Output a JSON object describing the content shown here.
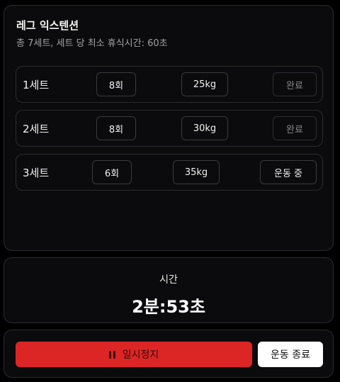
{
  "exercise": {
    "title": "레그 익스텐션",
    "subtitle": "총 7세트, 세트 당 최소 휴식시간: 60초"
  },
  "sets": [
    {
      "label": "1세트",
      "reps": "8회",
      "weight": "25kg",
      "status": "완료"
    },
    {
      "label": "2세트",
      "reps": "8회",
      "weight": "30kg",
      "status": "완료"
    },
    {
      "label": "3세트",
      "reps": "6회",
      "weight": "35kg",
      "status": "운동 중"
    }
  ],
  "timer": {
    "label": "시간",
    "value": "2분:53초"
  },
  "controls": {
    "pause_label": "일시정지",
    "end_label": "운동 종료",
    "pause_icon": "pause-icon"
  },
  "colors": {
    "pause_button": "#dc2626",
    "end_button": "#ffffff",
    "background": "#0b0b0d"
  }
}
